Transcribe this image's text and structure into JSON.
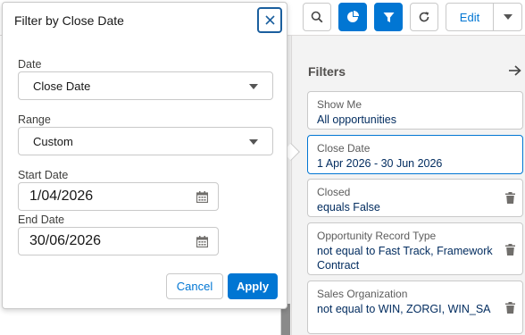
{
  "toolbar": {
    "edit_label": "Edit",
    "icons": [
      "search-icon",
      "chart-icon",
      "filter-icon",
      "refresh-icon",
      "chevron-down-icon"
    ]
  },
  "popover": {
    "title": "Filter by Close Date",
    "date_field_label": "Date",
    "date_field_value": "Close Date",
    "range_label": "Range",
    "range_value": "Custom",
    "start_label": "Start Date",
    "start_value": "1/04/2026",
    "end_label": "End Date",
    "end_value": "30/06/2026",
    "cancel_label": "Cancel",
    "apply_label": "Apply"
  },
  "filters": {
    "title": "Filters",
    "items": [
      {
        "label": "Show Me",
        "value": "All opportunities",
        "removable": false,
        "active": false
      },
      {
        "label": "Close Date",
        "value": "1 Apr 2026 - 30 Jun 2026",
        "removable": false,
        "active": true
      },
      {
        "label": "Closed",
        "value": "equals False",
        "removable": true,
        "active": false
      },
      {
        "label": "Opportunity Record Type",
        "value": "not equal to Fast Track, Framework Contract",
        "removable": true,
        "active": false
      },
      {
        "label": "Sales Organization",
        "value": "not equal to WIN, ZORGI, WIN_SA",
        "removable": true,
        "active": false
      }
    ]
  },
  "colors": {
    "brand": "#0176d3",
    "focus_border": "#1b5f9e",
    "filter_value": "#032d60",
    "background": "#f3f3f3"
  }
}
